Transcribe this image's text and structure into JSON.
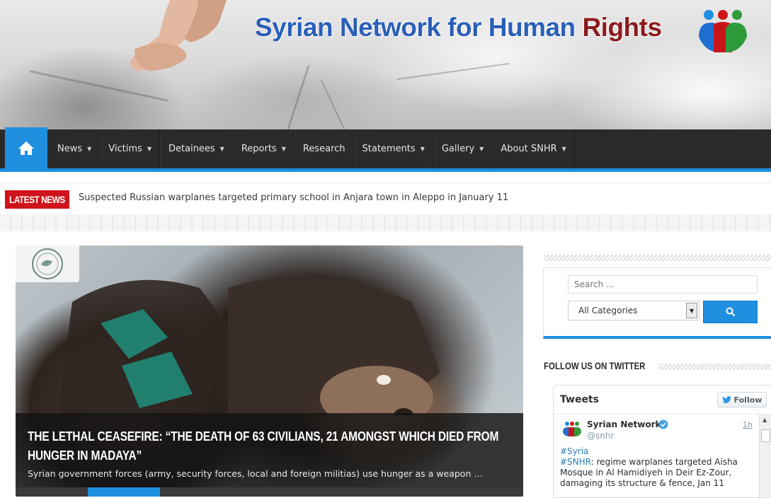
{
  "header": {
    "title_part1": "Syrian Network for Human ",
    "title_part2": "Rights"
  },
  "nav": {
    "home_icon": "home-icon",
    "items": [
      {
        "label": "News",
        "has_dropdown": true
      },
      {
        "label": "Victims",
        "has_dropdown": true
      },
      {
        "label": "Detainees",
        "has_dropdown": true
      },
      {
        "label": "Reports",
        "has_dropdown": true
      },
      {
        "label": "Research",
        "has_dropdown": false
      },
      {
        "label": "Statements",
        "has_dropdown": true
      },
      {
        "label": "Gallery",
        "has_dropdown": true
      },
      {
        "label": "About SNHR",
        "has_dropdown": true
      }
    ]
  },
  "latest_news": {
    "label": "LATEST NEWS",
    "headline": "Suspected Russian warplanes targeted primary school in Anjara town in Aleppo in January 11"
  },
  "featured": {
    "title": "The Lethal Ceasefire: “The Death of 63 Civilians, 21 amongst which died from Hunger in Madaya”",
    "excerpt": "Syrian government forces (army, security forces, local and foreign militias) use hunger as a weapon …"
  },
  "sidebar": {
    "search": {
      "placeholder": "Search ...",
      "category_selected": "All Categories",
      "button_icon": "search-icon"
    },
    "twitter": {
      "heading": "Follow us on Twitter",
      "widget_title": "Tweets",
      "follow_label": "Follow",
      "tweet": {
        "name": "Syrian Network",
        "handle": "@snhr",
        "time": "1h",
        "hashtag1": "#Syria",
        "hashtag2": "#SNHR",
        "text": ": regime warplanes targeted Aisha Mosque in Al Hamidiyeh in Deir Ez-Zour, damaging its structure & fence, Jan 11"
      }
    }
  },
  "colors": {
    "accent_blue": "#1f8fe0",
    "nav_bg": "#2a2a2a",
    "news_red": "#d0141b",
    "title_blue": "#2a5fb8",
    "title_red": "#8b1c1c"
  }
}
